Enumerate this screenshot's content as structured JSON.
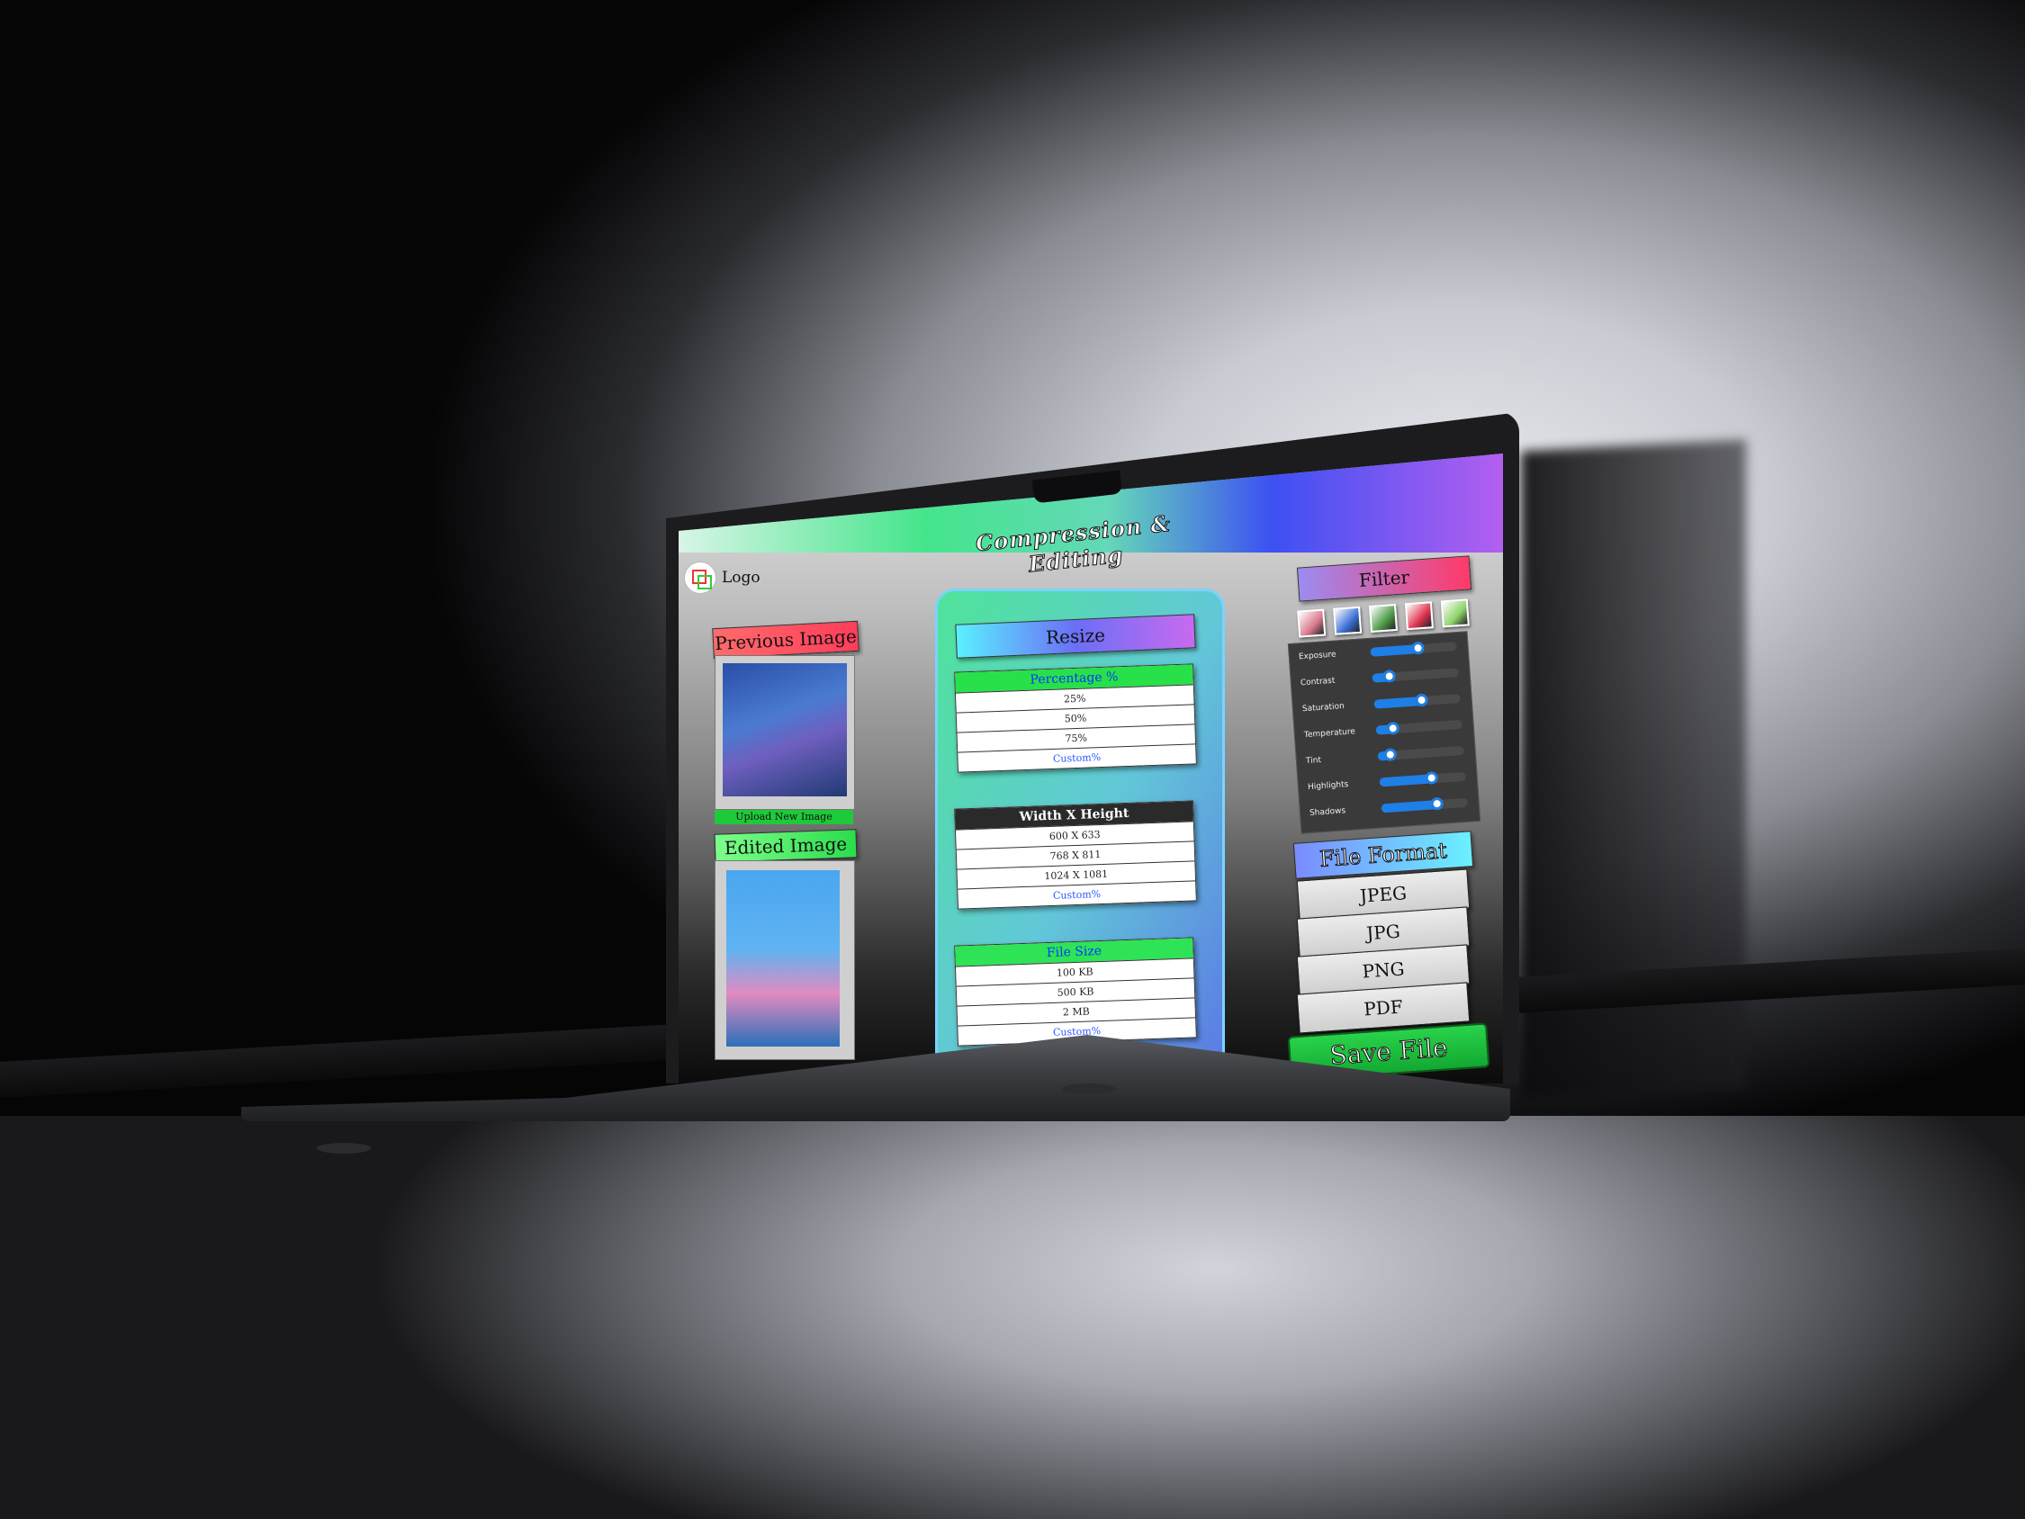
{
  "app": {
    "title": "Compression & Editing",
    "logo_text": "Logo"
  },
  "left": {
    "previous_label": "Previous Image",
    "upload_label": "Upload New Image",
    "edited_label": "Edited Image"
  },
  "resize": {
    "title": "Resize",
    "percentage": {
      "header": "Percentage %",
      "options": [
        "25%",
        "50%",
        "75%"
      ],
      "custom": "Custom%"
    },
    "dimensions": {
      "header": "Width X Height",
      "options": [
        "600 X 633",
        "768 X 811",
        "1024 X 1081"
      ],
      "custom": "Custom%"
    },
    "file_size": {
      "header": "File Size",
      "options": [
        "100 KB",
        "500 KB",
        "2 MB"
      ],
      "custom": "Custom%"
    }
  },
  "filter": {
    "title": "Filter",
    "thumbnail_colors": [
      "#d97a8f",
      "#3b6fd6",
      "#4f9c4a",
      "#e0344f",
      "#8fd36b"
    ],
    "adjustments": [
      {
        "name": "Exposure",
        "value": 0.55
      },
      {
        "name": "Contrast",
        "value": 0.2
      },
      {
        "name": "Saturation",
        "value": 0.55
      },
      {
        "name": "Temperature",
        "value": 0.2
      },
      {
        "name": "Tint",
        "value": 0.15
      },
      {
        "name": "Highlights",
        "value": 0.6
      },
      {
        "name": "Shadows",
        "value": 0.65
      }
    ]
  },
  "file_format": {
    "title": "File Format",
    "options": [
      "JPEG",
      "JPG",
      "PNG",
      "PDF"
    ]
  },
  "save_label": "Save File",
  "colors": {
    "accent_green": "#28e04a",
    "accent_blue": "#1e7fe6",
    "accent_red": "#ff3d5a"
  }
}
